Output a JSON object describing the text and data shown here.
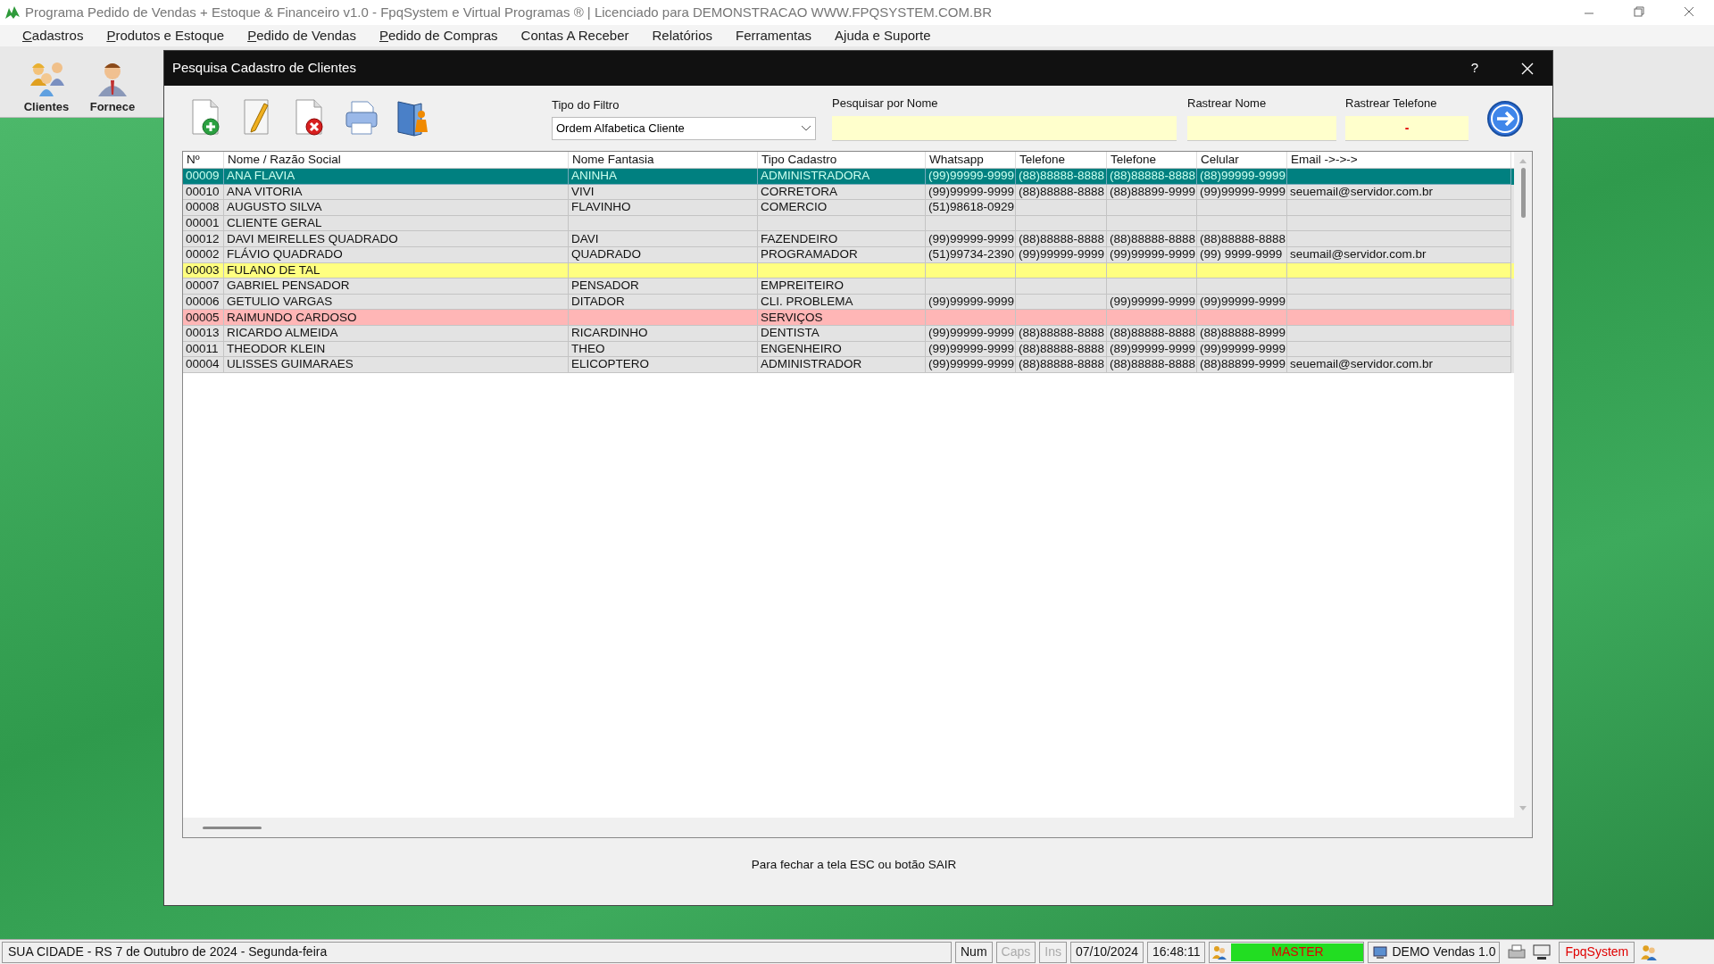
{
  "window": {
    "title": "Programa Pedido de Vendas + Estoque & Financeiro v1.0 - FpqSystem e Virtual Programas ® | Licenciado para  DEMONSTRACAO WWW.FPQSYSTEM.COM.BR"
  },
  "menu": [
    {
      "label": "Cadastros",
      "underlined": true
    },
    {
      "label": "Produtos e Estoque",
      "underlined": true
    },
    {
      "label": "Pedido de Vendas",
      "underlined": true
    },
    {
      "label": "Pedido de Compras",
      "underlined": true
    },
    {
      "label": "Contas A Receber",
      "underlined": false
    },
    {
      "label": "Relatórios",
      "underlined": false
    },
    {
      "label": "Ferramentas",
      "underlined": false
    },
    {
      "label": "Ajuda e Suporte",
      "underlined": false
    }
  ],
  "toolbar": [
    {
      "label": "Clientes",
      "kind": "group"
    },
    {
      "label": "Fornece",
      "kind": "person"
    }
  ],
  "dialog": {
    "title": "Pesquisa Cadastro de Clientes",
    "help": "?",
    "tools": [
      {
        "kind": "add"
      },
      {
        "kind": "edit"
      },
      {
        "kind": "delete"
      },
      {
        "kind": "print"
      },
      {
        "kind": "book"
      }
    ],
    "filter_type": {
      "label": "Tipo do Filtro",
      "value": "Ordem Alfabetica Cliente"
    },
    "search_name": {
      "label": "Pesquisar por Nome"
    },
    "track_name": {
      "label": "Rastrear Nome"
    },
    "track_phone": {
      "label": "Rastrear Telefone",
      "value": "-"
    },
    "table": {
      "columns": [
        "Nº",
        "Nome / Razão Social",
        "Nome Fantasia",
        "Tipo Cadastro",
        "Whatsapp",
        "Telefone",
        "Telefone",
        "Celular",
        "Email ->->->"
      ],
      "rows": [
        {
          "selected": true,
          "color": "#008080",
          "cells": [
            "00009",
            "ANA FLAVIA",
            "ANINHA",
            "ADMINISTRADORA",
            "(99)99999-9999",
            "(88)88888-8888",
            "(88)88888-8888",
            "(88)99999-9999",
            ""
          ]
        },
        {
          "selected": false,
          "color": "#e3e3e3",
          "cells": [
            "00010",
            "ANA VITORIA",
            "VIVI",
            "CORRETORA",
            "(99)99999-9999",
            "(88)88888-8888",
            "(88)88899-9999",
            "(99)99999-9999",
            "seuemail@servidor.com.br"
          ]
        },
        {
          "selected": false,
          "color": "#e3e3e3",
          "cells": [
            "00008",
            "AUGUSTO SILVA",
            "FLAVINHO",
            "COMERCIO",
            "(51)98618-0929",
            "",
            "",
            "",
            ""
          ]
        },
        {
          "selected": false,
          "color": "#e3e3e3",
          "cells": [
            "00001",
            "CLIENTE GERAL",
            "",
            "",
            "",
            "",
            "",
            "",
            ""
          ]
        },
        {
          "selected": false,
          "color": "#e3e3e3",
          "cells": [
            "00012",
            "DAVI MEIRELLES QUADRADO",
            "DAVI",
            "FAZENDEIRO",
            "(99)99999-9999",
            "(88)88888-8888",
            "(88)88888-8888",
            "(88)88888-8888",
            ""
          ]
        },
        {
          "selected": false,
          "color": "#e3e3e3",
          "cells": [
            "00002",
            "FLÁVIO QUADRADO",
            "QUADRADO",
            "PROGRAMADOR",
            "(51)99734-2390",
            "(99)99999-9999",
            "(99)99999-9999",
            "(99) 9999-9999",
            "seumail@servidor.com.br"
          ]
        },
        {
          "selected": false,
          "color": "#ffff80",
          "cells": [
            "00003",
            "FULANO DE TAL",
            "",
            "",
            "",
            "",
            "",
            "",
            ""
          ]
        },
        {
          "selected": false,
          "color": "#e3e3e3",
          "cells": [
            "00007",
            "GABRIEL PENSADOR",
            "PENSADOR",
            "EMPREITEIRO",
            "",
            "",
            "",
            "",
            ""
          ]
        },
        {
          "selected": false,
          "color": "#e3e3e3",
          "cells": [
            "00006",
            "GETULIO VARGAS",
            "DITADOR",
            "CLI. PROBLEMA",
            "(99)99999-9999",
            "",
            "(99)99999-9999",
            "(99)99999-9999",
            ""
          ]
        },
        {
          "selected": false,
          "color": "#ffb6b6",
          "cells": [
            "00005",
            "RAIMUNDO CARDOSO",
            "",
            "SERVIÇOS",
            "",
            "",
            "",
            "",
            ""
          ]
        },
        {
          "selected": false,
          "color": "#e3e3e3",
          "cells": [
            "00013",
            "RICARDO ALMEIDA",
            "RICARDINHO",
            "DENTISTA",
            "(99)99999-9999",
            "(88)88888-8888",
            "(88)88888-8888",
            "(88)88888-8999",
            ""
          ]
        },
        {
          "selected": false,
          "color": "#e3e3e3",
          "cells": [
            "00011",
            "THEODOR KLEIN",
            "THEO",
            "ENGENHEIRO",
            "(99)99999-9999",
            "(88)88888-8888",
            "(89)99999-9999",
            "(99)99999-9999",
            ""
          ]
        },
        {
          "selected": false,
          "color": "#e3e3e3",
          "cells": [
            "00004",
            "ULISSES GUIMARAES",
            "ELICOPTERO",
            "ADMINISTRADOR",
            "(99)99999-9999",
            "(88)88888-8888",
            "(88)88888-8888",
            "(88)88899-9999",
            "seuemail@servidor.com.br"
          ]
        }
      ]
    },
    "hint": "Para fechar a tela ESC ou botão SAIR"
  },
  "status_bar": [
    {
      "kind": "text",
      "text": "SUA CIDADE - RS  7 de Outubro de 2024 - Segunda-feira"
    },
    {
      "kind": "key",
      "text": "Num",
      "disabled": false
    },
    {
      "kind": "key",
      "text": "Caps",
      "disabled": true
    },
    {
      "kind": "key",
      "text": "Ins",
      "disabled": true
    },
    {
      "kind": "key",
      "text": "07/10/2024",
      "disabled": false
    },
    {
      "kind": "key",
      "text": "16:48:11",
      "disabled": false
    },
    {
      "kind": "user",
      "text": "MASTER"
    },
    {
      "kind": "version",
      "text": "DEMO Vendas 1.0"
    },
    {
      "kind": "tools"
    },
    {
      "kind": "brand",
      "text": "FpqSystem"
    }
  ]
}
